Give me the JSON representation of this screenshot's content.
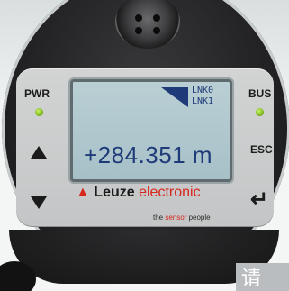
{
  "display": {
    "lnk_lines": "LNK0\nLNK1",
    "value": "+284.351 m"
  },
  "labels": {
    "pwr": "PWR",
    "bus": "BUS",
    "esc": "ESC"
  },
  "icons": {
    "up": "triangle-up",
    "down": "triangle-down",
    "enter": "enter-arrow"
  },
  "brand": {
    "logo": "▲",
    "name": "Leuze",
    "accent": "electronic"
  },
  "slogan": {
    "pre": "the ",
    "red": "sensor",
    "post": " people"
  },
  "corner_text": "请",
  "colors": {
    "lcd_text": "#1e3a78",
    "brand_red": "#d9261c",
    "led_green": "#7fb81e"
  }
}
